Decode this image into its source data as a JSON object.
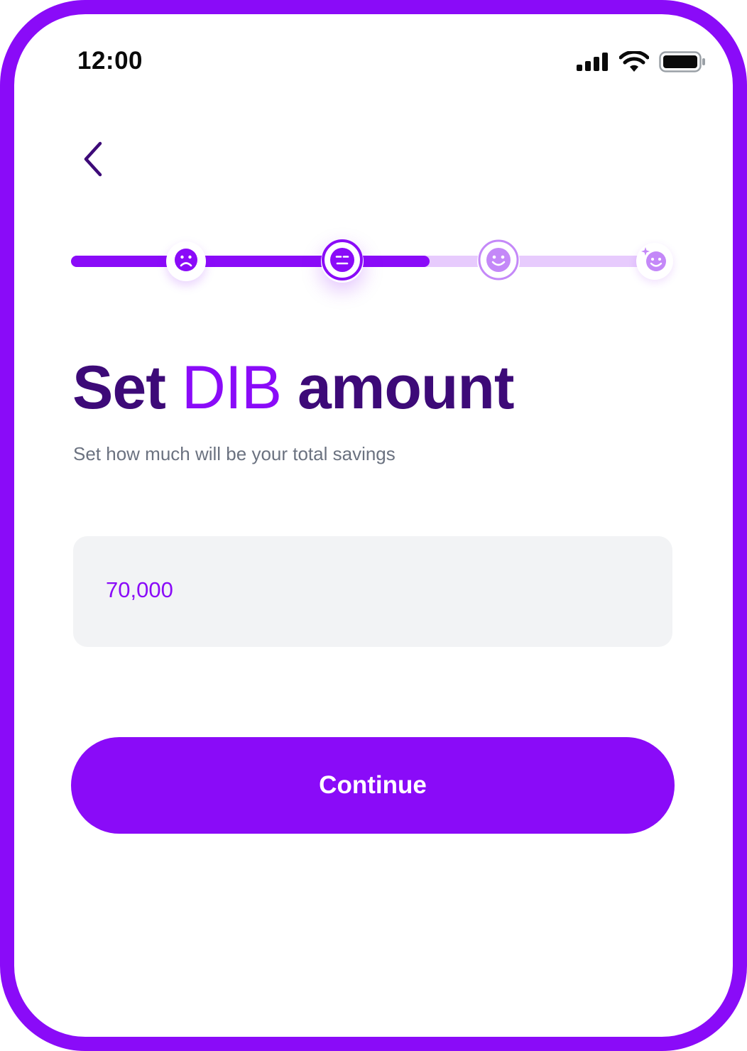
{
  "status_bar": {
    "time": "12:00",
    "icons": [
      "signal-icon",
      "wifi-icon",
      "battery-icon"
    ]
  },
  "nav": {
    "back_icon": "chevron-left-icon"
  },
  "progress": {
    "current_step": 2,
    "total_steps": 4,
    "fill_fraction": 0.595,
    "steps": [
      {
        "icon": "sad-face-icon",
        "state": "completed"
      },
      {
        "icon": "neutral-face-icon",
        "state": "current"
      },
      {
        "icon": "smile-face-icon",
        "state": "upcoming"
      },
      {
        "icon": "sparkle-face-icon",
        "state": "upcoming"
      }
    ]
  },
  "page": {
    "title_part1": "Set",
    "title_accent": "DIB",
    "title_part2": "amount",
    "subtitle": "Set how much will be your total savings"
  },
  "amount": {
    "value": "70,000"
  },
  "actions": {
    "continue_label": "Continue"
  },
  "colors": {
    "brand": "#8a0bf8",
    "title": "#3d0a78",
    "track_inactive": "#e7cbfd",
    "field_bg": "#f2f3f5"
  }
}
